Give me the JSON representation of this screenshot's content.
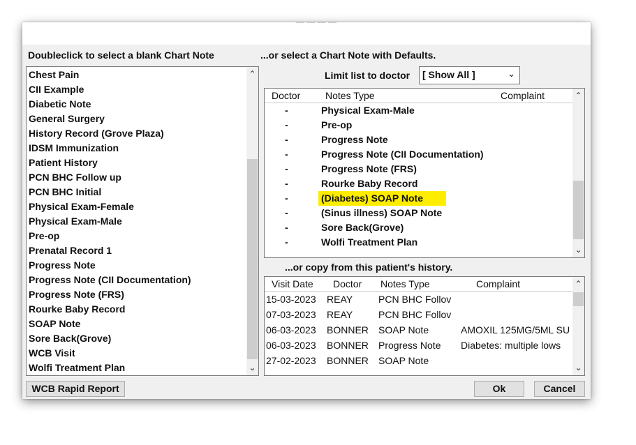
{
  "dialog": {
    "left_heading": "Doubleclick to select a blank Chart Note",
    "right_heading": "...or select a Chart Note with Defaults.",
    "history_heading": "...or copy from this patient's history.",
    "limit_label": "Limit list to doctor",
    "limit_value": "[ Show All ]"
  },
  "blank_notes": [
    "Chest Pain",
    "CII Example",
    "Diabetic Note",
    "General Surgery",
    "History Record (Grove Plaza)",
    "IDSM Immunization",
    "Patient History",
    "PCN BHC Follow up",
    "PCN BHC Initial",
    "Physical Exam-Female",
    "Physical Exam-Male",
    "Pre-op",
    "Prenatal Record 1",
    "Progress Note",
    "Progress Note (CII Documentation)",
    "Progress Note (FRS)",
    "Rourke Baby Record",
    "SOAP Note",
    "Sore Back(Grove)",
    "WCB Visit",
    "Wolfi Treatment Plan"
  ],
  "defaults_table": {
    "columns": [
      "Doctor",
      "Notes Type",
      "Complaint"
    ],
    "rows": [
      {
        "doctor": "-",
        "type": "Physical Exam-Male",
        "highlighted": false
      },
      {
        "doctor": "-",
        "type": "Pre-op",
        "highlighted": false
      },
      {
        "doctor": "-",
        "type": "Progress Note",
        "highlighted": false
      },
      {
        "doctor": "-",
        "type": "Progress Note (CII Documentation)",
        "highlighted": false
      },
      {
        "doctor": "-",
        "type": "Progress Note (FRS)",
        "highlighted": false
      },
      {
        "doctor": "-",
        "type": "Rourke Baby Record",
        "highlighted": false
      },
      {
        "doctor": "-",
        "type": "(Diabetes) SOAP Note",
        "highlighted": true
      },
      {
        "doctor": "-",
        "type": "(Sinus illness) SOAP Note",
        "highlighted": false
      },
      {
        "doctor": "-",
        "type": "Sore Back(Grove)",
        "highlighted": false
      },
      {
        "doctor": "-",
        "type": "Wolfi Treatment Plan",
        "highlighted": false
      }
    ]
  },
  "history_table": {
    "columns": [
      "Visit Date",
      "Doctor",
      "Notes Type",
      "Complaint"
    ],
    "rows": [
      {
        "date": "15-03-2023",
        "doctor": "REAY",
        "type": "PCN BHC Follov",
        "complaint": ""
      },
      {
        "date": "07-03-2023",
        "doctor": "REAY",
        "type": "PCN BHC Follov",
        "complaint": ""
      },
      {
        "date": "06-03-2023",
        "doctor": "BONNER",
        "type": "SOAP Note",
        "complaint": "AMOXIL 125MG/5ML SU"
      },
      {
        "date": "06-03-2023",
        "doctor": "BONNER",
        "type": "Progress Note",
        "complaint": "Diabetes: multiple lows"
      },
      {
        "date": "27-02-2023",
        "doctor": "BONNER",
        "type": "SOAP Note",
        "complaint": ""
      }
    ]
  },
  "buttons": {
    "wcb": "WCB Rapid Report",
    "ok": "Ok",
    "cancel": "Cancel"
  },
  "highlight_color": "#ffed00"
}
